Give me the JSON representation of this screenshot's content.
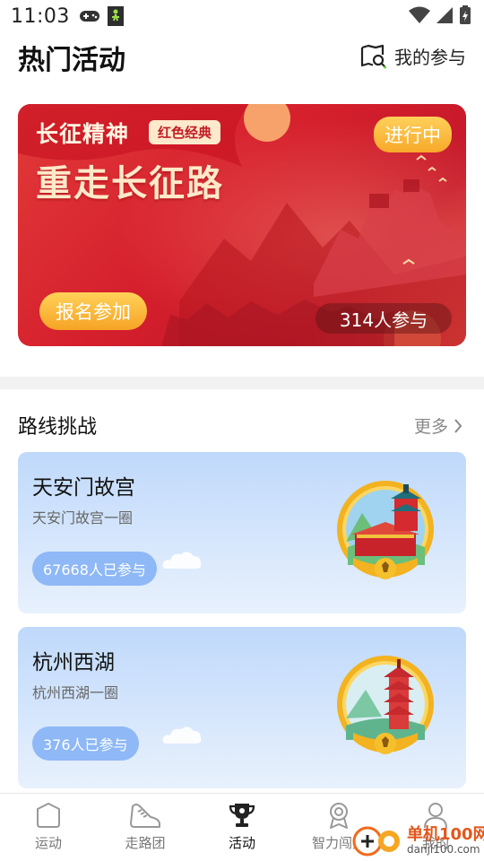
{
  "status_bar": {
    "time": "11:03"
  },
  "header": {
    "title": "热门活动",
    "my_participation": "我的参与"
  },
  "banner": {
    "tag_title": "长征精神",
    "badge": "红色经典",
    "main_title": "重走长征路",
    "status": "进行中",
    "signup_label": "报名参加",
    "participants": "314人参与",
    "colors": {
      "primary": "#d51f2c",
      "accent": "#f7a92a"
    }
  },
  "routes_section": {
    "title": "路线挑战",
    "more_label": "更多",
    "cards": [
      {
        "name": "天安门故宫",
        "subtitle": "天安门故宫一圈",
        "participants": "67668人已参与"
      },
      {
        "name": "杭州西湖",
        "subtitle": "杭州西湖一圈",
        "participants": "376人已参与"
      }
    ]
  },
  "bottom_nav": {
    "active": "活动",
    "items": [
      {
        "label": "运动",
        "icon": "shield-icon"
      },
      {
        "label": "走路团",
        "icon": "shoe-icon"
      },
      {
        "label": "活动",
        "icon": "trophy-icon"
      },
      {
        "label": "智力闯关",
        "icon": "medal-icon"
      },
      {
        "label": "我的",
        "icon": "person-icon"
      }
    ]
  },
  "watermark": {
    "text": "单机100网",
    "url_text": "danji100.com"
  }
}
